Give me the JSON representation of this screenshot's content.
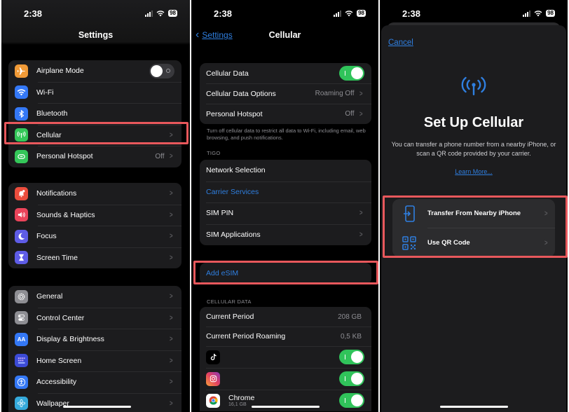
{
  "status_bar": {
    "time": "2:38",
    "battery": "98"
  },
  "settings": {
    "title": "Settings",
    "groups": [
      {
        "items": [
          {
            "label": "Airplane Mode",
            "icon": "airplane-icon",
            "color": "#f09a37",
            "toggle": false
          },
          {
            "label": "Wi-Fi",
            "icon": "wifi-icon",
            "color": "#3478f6"
          },
          {
            "label": "Bluetooth",
            "icon": "bluetooth-icon",
            "color": "#3478f6"
          },
          {
            "label": "Cellular",
            "icon": "antenna-icon",
            "color": "#34c759",
            "highlighted": true
          },
          {
            "label": "Personal Hotspot",
            "icon": "hotspot-icon",
            "color": "#34c759",
            "value": "Off"
          }
        ]
      },
      {
        "items": [
          {
            "label": "Notifications",
            "icon": "bell-icon",
            "color": "#eb4d3d"
          },
          {
            "label": "Sounds & Haptics",
            "icon": "speaker-icon",
            "color": "#eb445a"
          },
          {
            "label": "Focus",
            "icon": "moon-icon",
            "color": "#5e5ce6"
          },
          {
            "label": "Screen Time",
            "icon": "hourglass-icon",
            "color": "#5e5ce6"
          }
        ]
      },
      {
        "items": [
          {
            "label": "General",
            "icon": "gear-icon",
            "color": "#8e8e93"
          },
          {
            "label": "Control Center",
            "icon": "switches-icon",
            "color": "#8e8e93"
          },
          {
            "label": "Display & Brightness",
            "icon": "text-size-icon",
            "color": "#3478f6"
          },
          {
            "label": "Home Screen",
            "icon": "home-grid-icon",
            "color": "#3c4bd6"
          },
          {
            "label": "Accessibility",
            "icon": "accessibility-icon",
            "color": "#3478f6"
          },
          {
            "label": "Wallpaper",
            "icon": "flower-icon",
            "color": "#35aadc"
          }
        ]
      }
    ]
  },
  "cellular": {
    "back_label": "Settings",
    "title": "Cellular",
    "group1": [
      {
        "label": "Cellular Data",
        "toggle": true
      },
      {
        "label": "Cellular Data Options",
        "value": "Roaming Off"
      },
      {
        "label": "Personal Hotspot",
        "value": "Off"
      }
    ],
    "footnote": "Turn off cellular data to restrict all data to Wi-Fi, including email, web browsing, and push notifications.",
    "carrier_header": "TIGO",
    "carrier_items": [
      {
        "label": "Network Selection"
      },
      {
        "label": "Carrier Services",
        "link": true
      },
      {
        "label": "SIM PIN"
      },
      {
        "label": "SIM Applications"
      }
    ],
    "add_esim": "Add eSIM",
    "data_header": "CELLULAR DATA",
    "usage": [
      {
        "label": "Current Period",
        "value": "208 GB"
      },
      {
        "label": "Current Period Roaming",
        "value": "0,5 KB"
      }
    ],
    "apps": [
      {
        "name": "",
        "icon": "tiktok-icon",
        "toggle": true
      },
      {
        "name": "",
        "icon": "instagram-icon",
        "toggle": true
      },
      {
        "name": "Chrome",
        "sub": "16,1 GB",
        "icon": "chrome-icon",
        "toggle": true
      }
    ]
  },
  "setup": {
    "cancel": "Cancel",
    "title": "Set Up Cellular",
    "description": "You can transfer a phone number from a nearby iPhone, or scan a QR code provided by your carrier.",
    "learn_more": "Learn More...",
    "options": [
      {
        "label": "Transfer From Nearby iPhone",
        "icon": "phone-transfer-icon"
      },
      {
        "label": "Use QR Code",
        "icon": "qr-code-icon"
      }
    ]
  },
  "colors": {
    "accent": "#2f7fe0",
    "highlight": "#e8585c",
    "toggle_on": "#30c35a"
  }
}
